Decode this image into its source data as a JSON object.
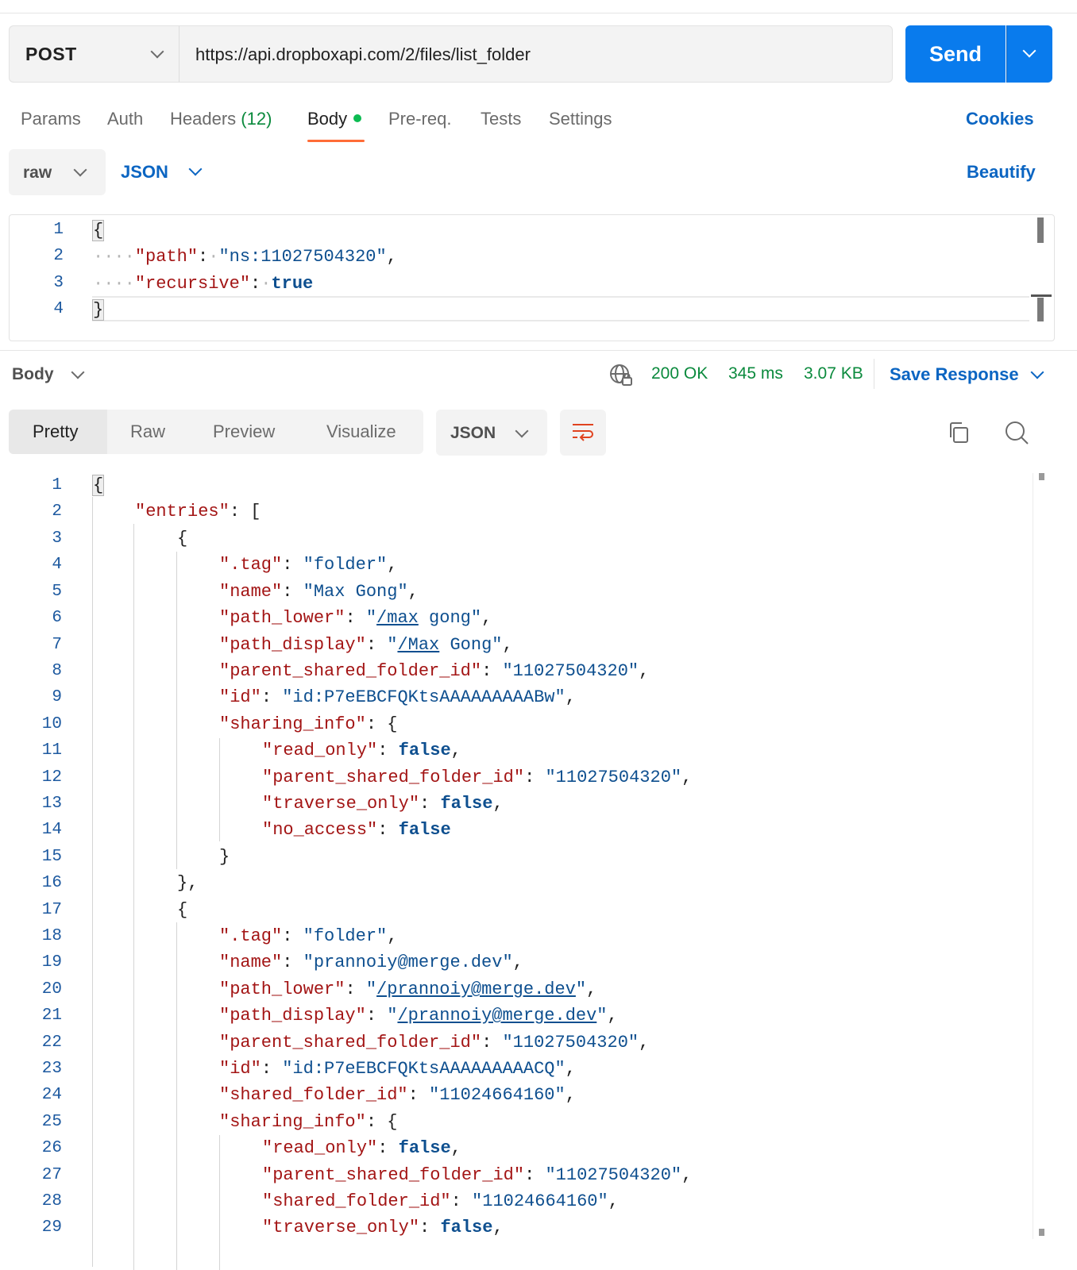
{
  "request": {
    "method": "POST",
    "url": "https://api.dropboxapi.com/2/files/list_folder",
    "send_label": "Send"
  },
  "tabs": {
    "params": "Params",
    "auth": "Auth",
    "headers": "Headers",
    "headers_count": "(12)",
    "body": "Body",
    "prereq": "Pre-req.",
    "tests": "Tests",
    "settings": "Settings",
    "cookies": "Cookies"
  },
  "body_options": {
    "mode": "raw",
    "language": "JSON",
    "beautify": "Beautify"
  },
  "request_body": {
    "line_numbers": [
      "1",
      "2",
      "3",
      "4"
    ],
    "open_brace": "{",
    "close_brace": "}",
    "key_path": "\"path\"",
    "val_path": "\"ns:11027504320\"",
    "key_recursive": "\"recursive\"",
    "val_recursive": "true"
  },
  "response": {
    "body_label": "Body",
    "status": "200 OK",
    "time": "345 ms",
    "size": "3.07 KB",
    "save_response": "Save Response",
    "views": {
      "pretty": "Pretty",
      "raw": "Raw",
      "preview": "Preview",
      "visualize": "Visualize"
    },
    "format": "JSON"
  },
  "response_body": {
    "line_numbers": [
      "1",
      "2",
      "3",
      "4",
      "5",
      "6",
      "7",
      "8",
      "9",
      "10",
      "11",
      "12",
      "13",
      "14",
      "15",
      "16",
      "17",
      "18",
      "19",
      "20",
      "21",
      "22",
      "23",
      "24",
      "25",
      "26",
      "27",
      "28",
      "29"
    ],
    "l1": "{",
    "k_entries": "\"entries\"",
    "open_bracket": "[",
    "brace_open": "{",
    "brace_close": "}",
    "brace_close_comma": "},",
    "k_tag": "\".tag\"",
    "k_name": "\"name\"",
    "k_path_lower": "\"path_lower\"",
    "k_path_display": "\"path_display\"",
    "k_parent_shared_folder_id": "\"parent_shared_folder_id\"",
    "k_id": "\"id\"",
    "k_sharing_info": "\"sharing_info\"",
    "k_read_only": "\"read_only\"",
    "k_traverse_only": "\"traverse_only\"",
    "k_no_access": "\"no_access\"",
    "k_shared_folder_id": "\"shared_folder_id\"",
    "v_folder": "\"folder\"",
    "v_false": "false",
    "v_parent_id": "\"11027504320\"",
    "e1": {
      "name": "\"Max Gong\"",
      "path_lower_q": "\"",
      "path_lower_u1": "/max",
      "path_lower_rest": " gong\"",
      "path_display_u1": "/Max",
      "path_display_rest": " Gong\"",
      "id": "\"id:P7eEBCFQKtsAAAAAAAAABw\""
    },
    "e2": {
      "name": "\"prannoiy@merge.dev\"",
      "path_lower_u": "/prannoiy@merge.dev",
      "path_display_u": "/prannoiy@merge.dev",
      "id": "\"id:P7eEBCFQKtsAAAAAAAAACQ\"",
      "shared_folder_id": "\"11024664160\""
    }
  }
}
